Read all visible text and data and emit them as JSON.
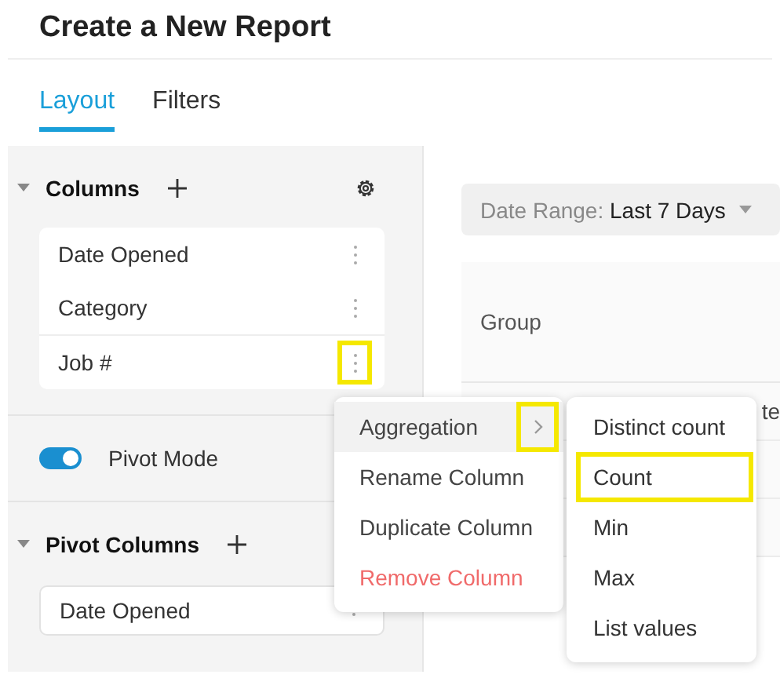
{
  "title": "Create a New Report",
  "tabs": [
    {
      "label": "Layout",
      "selected": true
    },
    {
      "label": "Filters",
      "selected": false
    }
  ],
  "columns_section": {
    "title": "Columns",
    "expanded": true,
    "items": [
      {
        "label": "Date Opened",
        "highlighted": false
      },
      {
        "label": "Category",
        "highlighted": false
      },
      {
        "label": "Job #",
        "highlighted": true
      }
    ]
  },
  "pivot_mode": {
    "label": "Pivot Mode",
    "on": true
  },
  "pivot_columns_section": {
    "title": "Pivot Columns",
    "expanded": true,
    "items": [
      {
        "label": "Date Opened",
        "highlighted": false
      }
    ]
  },
  "date_range": {
    "label": "Date Range:",
    "value": "Last 7 Days"
  },
  "table": {
    "header": "Group",
    "cell": "te"
  },
  "context_menu": [
    {
      "label": "Aggregation",
      "kind": "submenu",
      "selected": true,
      "highlighted": true
    },
    {
      "label": "Rename Column",
      "kind": "normal",
      "selected": false
    },
    {
      "label": "Duplicate Column",
      "kind": "normal",
      "selected": false
    },
    {
      "label": "Remove Column",
      "kind": "danger",
      "selected": false
    }
  ],
  "submenu": [
    {
      "label": "Distinct count",
      "highlighted": false
    },
    {
      "label": "Count",
      "highlighted": true
    },
    {
      "label": "Min",
      "highlighted": false
    },
    {
      "label": "Max",
      "highlighted": false
    },
    {
      "label": "List values",
      "highlighted": false
    }
  ]
}
